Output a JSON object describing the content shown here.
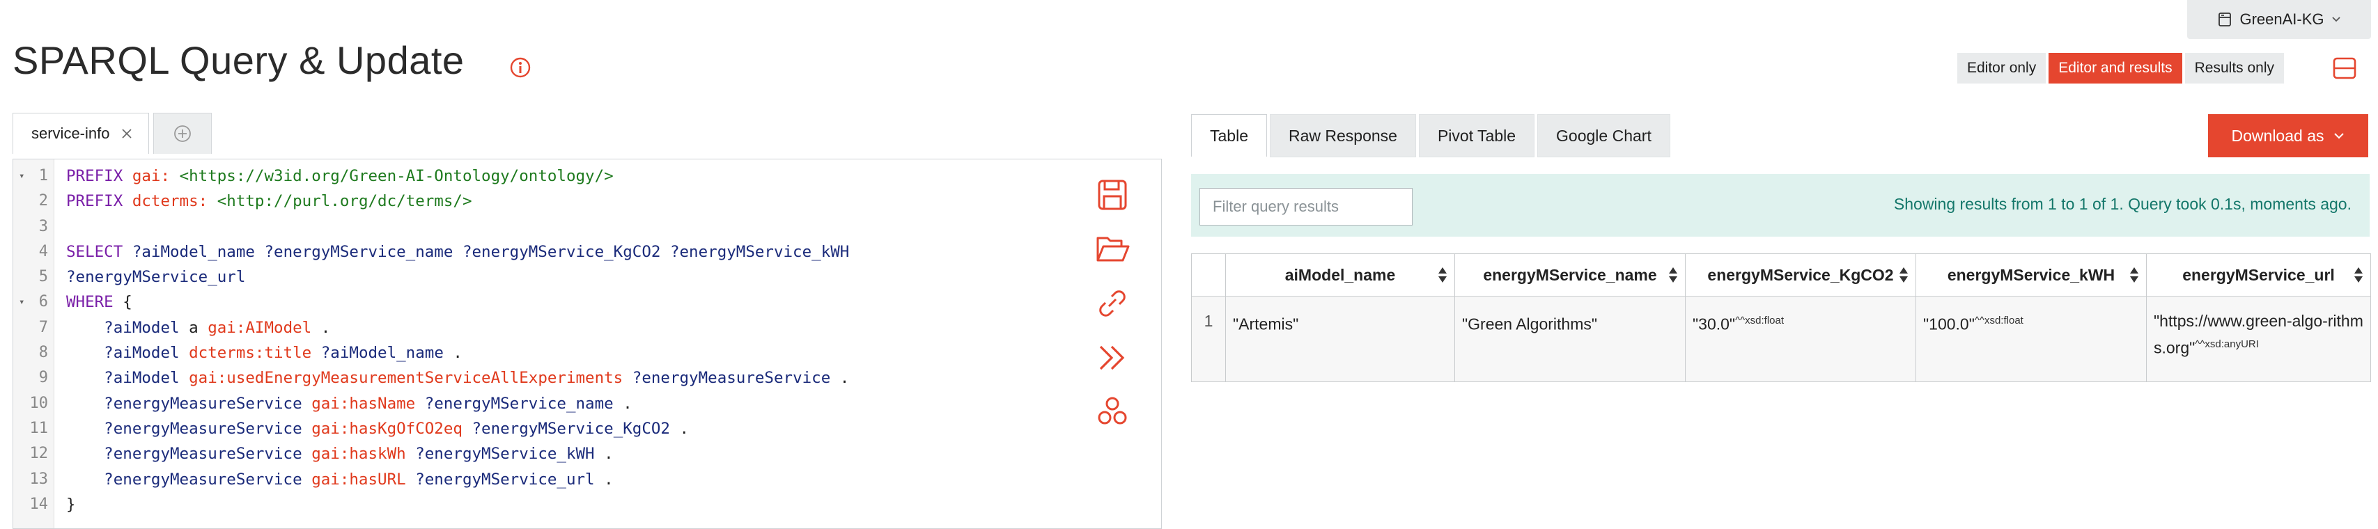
{
  "repo": {
    "name": "GreenAI-KG"
  },
  "page": {
    "title": "SPARQL Query & Update"
  },
  "view_modes": [
    {
      "label": "Editor only",
      "active": false
    },
    {
      "label": "Editor and results",
      "active": true
    },
    {
      "label": "Results only",
      "active": false
    }
  ],
  "editor": {
    "tab_name": "service-info",
    "lines": [
      {
        "n": "1",
        "fold": true,
        "tokens": [
          [
            "kw",
            "PREFIX "
          ],
          [
            "pfx",
            "gai: "
          ],
          [
            "iri",
            "<https://w3id.org/Green-AI-Ontology/ontology/>"
          ]
        ]
      },
      {
        "n": "2",
        "tokens": [
          [
            "kw",
            "PREFIX "
          ],
          [
            "pfx",
            "dcterms: "
          ],
          [
            "iri",
            "<http://purl.org/dc/terms/>"
          ]
        ]
      },
      {
        "n": "3",
        "tokens": []
      },
      {
        "n": "4",
        "tokens": [
          [
            "kw",
            "SELECT "
          ],
          [
            "var",
            "?aiModel_name ?energyMService_name ?energyMService_KgCO2 ?energyMService_kWH"
          ]
        ]
      },
      {
        "n": "5",
        "tokens": [
          [
            "var",
            "?energyMService_url"
          ]
        ]
      },
      {
        "n": "6",
        "fold": true,
        "tokens": [
          [
            "kw",
            "WHERE "
          ],
          [
            "pn",
            "{"
          ]
        ]
      },
      {
        "n": "7",
        "tokens": [
          [
            "var",
            "    ?aiModel "
          ],
          [
            "pn",
            "a "
          ],
          [
            "pfx",
            "gai:AIModel "
          ],
          [
            "pn",
            "."
          ]
        ]
      },
      {
        "n": "8",
        "tokens": [
          [
            "var",
            "    ?aiModel "
          ],
          [
            "pfx",
            "dcterms:title "
          ],
          [
            "var",
            "?aiModel_name "
          ],
          [
            "pn",
            "."
          ]
        ]
      },
      {
        "n": "9",
        "tokens": [
          [
            "var",
            "    ?aiModel "
          ],
          [
            "pfx",
            "gai:usedEnergyMeasurementServiceAllExperiments "
          ],
          [
            "var",
            "?energyMeasureService "
          ],
          [
            "pn",
            "."
          ]
        ]
      },
      {
        "n": "10",
        "tokens": [
          [
            "var",
            "    ?energyMeasureService "
          ],
          [
            "pfx",
            "gai:hasName "
          ],
          [
            "var",
            "?energyMService_name "
          ],
          [
            "pn",
            "."
          ]
        ]
      },
      {
        "n": "11",
        "tokens": [
          [
            "var",
            "    ?energyMeasureService "
          ],
          [
            "pfx",
            "gai:hasKgOfCO2eq "
          ],
          [
            "var",
            "?energyMService_KgCO2 "
          ],
          [
            "pn",
            "."
          ]
        ]
      },
      {
        "n": "12",
        "tokens": [
          [
            "var",
            "    ?energyMeasureService "
          ],
          [
            "pfx",
            "gai:haskWh "
          ],
          [
            "var",
            "?energyMService_kWH "
          ],
          [
            "pn",
            "."
          ]
        ]
      },
      {
        "n": "13",
        "tokens": [
          [
            "var",
            "    ?energyMeasureService "
          ],
          [
            "pfx",
            "gai:hasURL "
          ],
          [
            "var",
            "?energyMService_url "
          ],
          [
            "pn",
            "."
          ]
        ]
      },
      {
        "n": "14",
        "tokens": [
          [
            "pn",
            "}"
          ]
        ]
      }
    ],
    "tools": [
      "save-icon",
      "open-folder-icon",
      "link-icon",
      "run-chevrons-icon",
      "share-nodes-icon"
    ]
  },
  "results": {
    "tabs": [
      {
        "label": "Table",
        "active": true
      },
      {
        "label": "Raw Response",
        "active": false
      },
      {
        "label": "Pivot Table",
        "active": false
      },
      {
        "label": "Google Chart",
        "active": false
      }
    ],
    "download_label": "Download as",
    "filter_placeholder": "Filter query results",
    "stats_text": "Showing results from 1 to 1 of 1. Query took 0.1s, moments ago.",
    "columns": [
      "aiModel_name",
      "energyMService_name",
      "energyMService_KgCO2",
      "energyMService_kWH",
      "energyMService_url"
    ],
    "rows": [
      {
        "num": "1",
        "cells": [
          {
            "value": "\"Artemis\"",
            "dtype": ""
          },
          {
            "value": "\"Green Algorithms\"",
            "dtype": ""
          },
          {
            "value": "\"30.0\"",
            "dtype": "^^xsd:float"
          },
          {
            "value": "\"100.0\"",
            "dtype": "^^xsd:float"
          },
          {
            "value": "\"https://www.green-algo-rithms.org\"",
            "dtype": "^^xsd:anyURI"
          }
        ]
      }
    ]
  },
  "colors": {
    "accent": "#e5462f",
    "info_bg": "#dff2ee",
    "info_text": "#14776a"
  }
}
